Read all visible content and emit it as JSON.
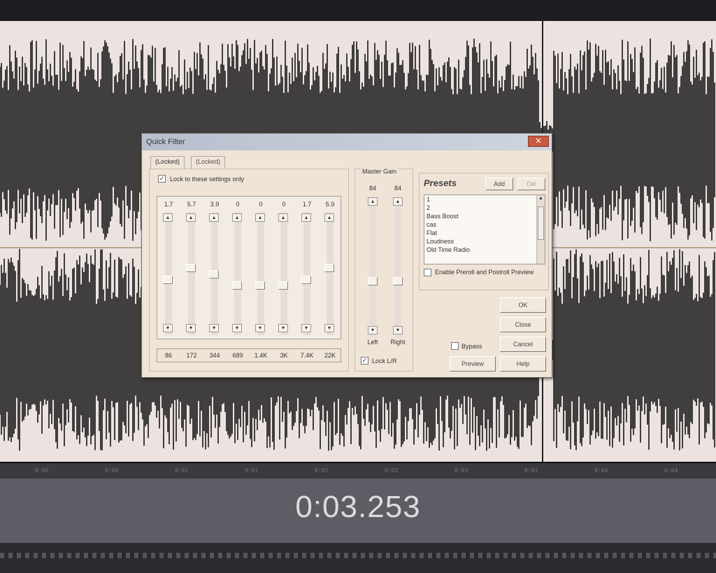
{
  "editor": {
    "time_readout": "0:03.253",
    "ruler_ticks": [
      "0:00",
      "0:00",
      "0:01",
      "0:01",
      "0:02",
      "0:02",
      "0:03",
      "0:03",
      "0:04",
      "0:04"
    ]
  },
  "dialog": {
    "title": "Quick Filter",
    "close_label": "✕",
    "tabs": [
      {
        "label": "(Locked)"
      },
      {
        "label": "(Locked)"
      }
    ],
    "lock_settings": {
      "label": "Lock to these settings only",
      "checked": "✓"
    },
    "bands": [
      {
        "value": "1.7",
        "freq": "86",
        "level": 0.56
      },
      {
        "value": "5.7",
        "freq": "172",
        "level": 0.7
      },
      {
        "value": "3.9",
        "freq": "344",
        "level": 0.63
      },
      {
        "value": "0",
        "freq": "689",
        "level": 0.5
      },
      {
        "value": "0",
        "freq": "1.4K",
        "level": 0.5
      },
      {
        "value": "0",
        "freq": "3K",
        "level": 0.5
      },
      {
        "value": "1.7",
        "freq": "7.4K",
        "level": 0.56
      },
      {
        "value": "5.9",
        "freq": "22K",
        "level": 0.7
      }
    ],
    "master_gain": {
      "title": "Master Gain",
      "left": {
        "value": "84",
        "label": "Left"
      },
      "right": {
        "value": "84",
        "label": "Right"
      },
      "lock_lr": {
        "label": "Lock L/R",
        "checked": "✓"
      }
    },
    "presets": {
      "title": "Presets",
      "add_label": "Add",
      "del_label": "Del",
      "items": [
        "1",
        "2",
        "Bass Boost",
        "cas",
        "Flat",
        "Loudness",
        "Old Time Radio"
      ],
      "enable_label": "Enable Preroll and Postroll Preview"
    },
    "buttons": {
      "ok": "OK",
      "close": "Close",
      "cancel": "Cancel",
      "help": "Help",
      "preview": "Preview",
      "bypass": "Bypass"
    }
  }
}
